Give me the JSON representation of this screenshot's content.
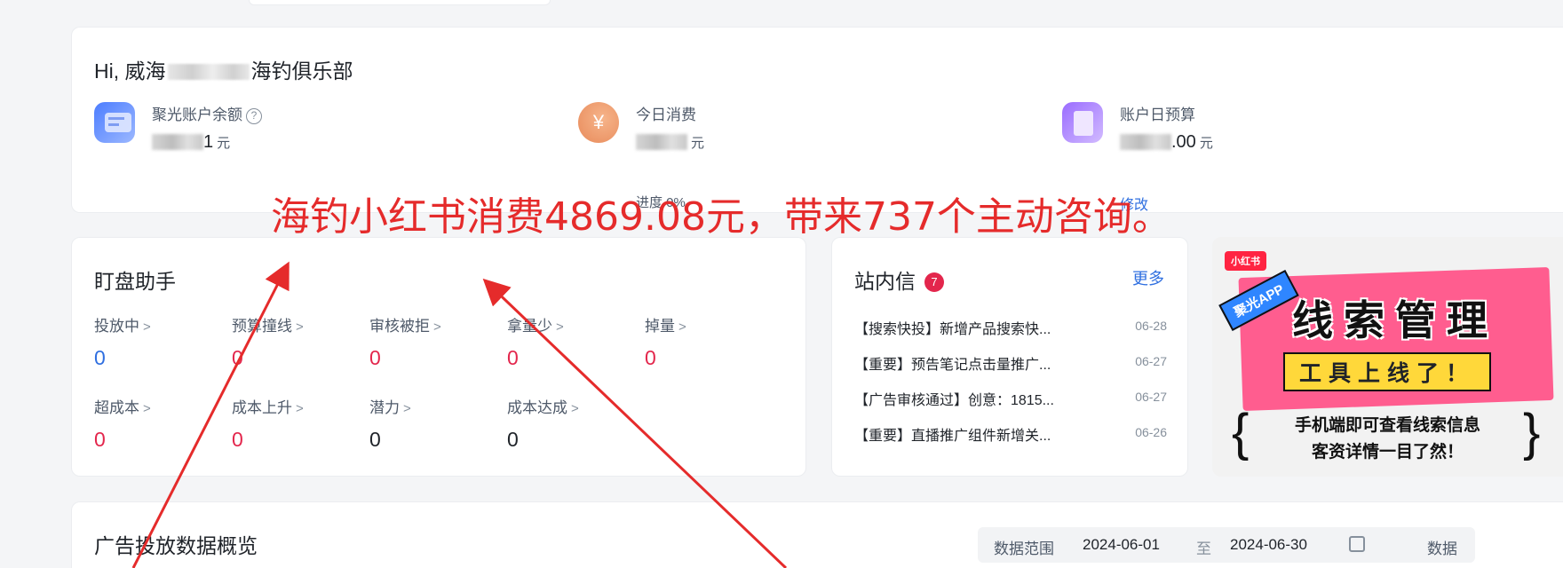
{
  "colors": {
    "accent_blue": "#2f6fe0",
    "alert_red": "#e3264c",
    "annotation_red": "#e52b2b"
  },
  "account": {
    "greeting_prefix": "Hi, 威海",
    "greeting_suffix": "海钓俱乐部",
    "metrics": [
      {
        "icon": "card-icon",
        "label": "聚光账户余额",
        "value_suffix": "1",
        "unit": "元"
      },
      {
        "icon": "yuan-coin-icon",
        "label": "今日消费",
        "value_suffix": "",
        "unit": "元",
        "sub": "进度 0%"
      },
      {
        "icon": "document-icon",
        "label": "账户日预算",
        "value_suffix": ".00",
        "unit": "元",
        "link": "修改"
      }
    ]
  },
  "monitor": {
    "title": "盯盘助手",
    "items": [
      {
        "label": "投放中",
        "value": "0",
        "color": "#2f6fe0"
      },
      {
        "label": "预算撞线",
        "value": "0",
        "color": "#e3264c"
      },
      {
        "label": "审核被拒",
        "value": "0",
        "color": "#e3264c"
      },
      {
        "label": "拿量少",
        "value": "0",
        "color": "#e3264c"
      },
      {
        "label": "掉量",
        "value": "0",
        "color": "#e3264c"
      },
      {
        "label": "超成本",
        "value": "0",
        "color": "#e3264c"
      },
      {
        "label": "成本上升",
        "value": "0",
        "color": "#e3264c"
      },
      {
        "label": "潜力",
        "value": "0",
        "color": "#1f2329"
      },
      {
        "label": "成本达成",
        "value": "0",
        "color": "#1f2329"
      }
    ]
  },
  "messages": {
    "title": "站内信",
    "badge": "7",
    "more": "更多",
    "items": [
      {
        "title": "【搜索快投】新增产品搜索快...",
        "date": "06-28"
      },
      {
        "title": "【重要】预告笔记点击量推广...",
        "date": "06-27"
      },
      {
        "title": "【广告审核通过】创意：1815...",
        "date": "06-27"
      },
      {
        "title": "【重要】直播推广组件新增关...",
        "date": "06-26"
      }
    ]
  },
  "promo": {
    "xhs_tag": "小红书",
    "app_tag": "聚光APP",
    "headline": "线索管理",
    "subline": "工具上线了！",
    "line1": "手机端即可查看线索信息",
    "line2": "客资详情一目了然！"
  },
  "overview": {
    "title": "广告投放数据概览",
    "range_label": "数据范围",
    "start": "2024-06-01",
    "separator": "至",
    "end": "2024-06-30",
    "data_label": "数据"
  },
  "annotation": "海钓小红书消费4869.08元，带来737个主动咨询。"
}
